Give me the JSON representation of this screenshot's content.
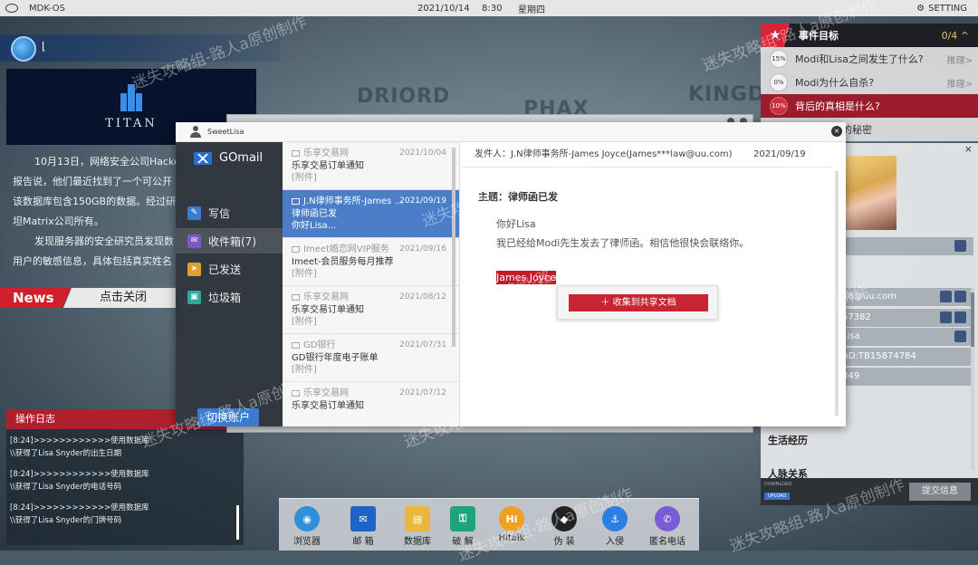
{
  "topbar": {
    "os_name": "MDK-OS",
    "date": "2021/10/14",
    "time": "8:30",
    "weekday": "星期四",
    "setting_label": "SETTING"
  },
  "map_labels": [
    "DRIORD",
    "PHAX",
    "KINGDO"
  ],
  "left_panel": {
    "company_name": "TITAN",
    "news_lines": [
      "10月13日，网络安全公司Hacke",
      "报告说，他们最近找到了一个可公开",
      "该数据库包含150GB的数据。经过研",
      "坦Matrix公司所有。",
      "发现服务器的安全研究员发现数",
      "用户的敏感信息，具体包括真实姓名"
    ],
    "news_tag": "News",
    "news_close": "点击关闭"
  },
  "oplog": {
    "title": "操作日志",
    "entries": [
      {
        "line1": "[8:24]>>>>>>>>>>>>使用数据库",
        "line2": "\\\\获得了Lisa Snyder的出生日期"
      },
      {
        "line1": "[8:24]>>>>>>>>>>>>使用数据库",
        "line2": "\\\\获得了Lisa Snyder的电话号码"
      },
      {
        "line1": "[8:24]>>>>>>>>>>>>使用数据库",
        "line2": "\\\\获得了Lisa Snyder的门牌号码"
      }
    ]
  },
  "events": {
    "title": "事件目标",
    "count": "0/4",
    "items": [
      {
        "pct": "15%",
        "question": "Modi和Lisa之间发生了什么?",
        "hint": "推理>"
      },
      {
        "pct": "0%",
        "question": "Modi为什么自杀?",
        "hint": "推理>"
      },
      {
        "pct": "10%",
        "question": "背后的真相是什么?",
        "hint": ""
      },
      {
        "pct": "",
        "question": "的秘密",
        "hint": ""
      }
    ]
  },
  "profile": {
    "close": "×",
    "rows": [
      "88@uu.com",
      "57382",
      "Lisa",
      "AD:TB15874784",
      "349"
    ],
    "section_life": "生活经历",
    "section_relations": "人脉关系",
    "download_label": "DOWNLOAD",
    "upload_label": "UPLOAD",
    "submit_label": "提交信息"
  },
  "gmail": {
    "window_user": "SweetLisa",
    "brand": "GOmail",
    "nav": [
      {
        "label": "写信",
        "icon": "compose-icon",
        "color": "#3a7bcf",
        "glyph": "✎"
      },
      {
        "label": "收件箱(7)",
        "icon": "inbox-icon",
        "color": "#7e57c2",
        "glyph": "✉"
      },
      {
        "label": "已发送",
        "icon": "sent-icon",
        "color": "#e0a030",
        "glyph": "➤"
      },
      {
        "label": "垃圾箱",
        "icon": "trash-icon",
        "color": "#2fa8a0",
        "glyph": "▣"
      }
    ],
    "switch_account": "切换账户",
    "mails": [
      {
        "from": "乐享交易网",
        "date": "2021/10/04",
        "subject": "乐享交易订单通知",
        "preview": "[附件]"
      },
      {
        "from": "J.N律师事务所-James ...",
        "date": "2021/09/19",
        "subject": "律师函已发",
        "preview": "你好Lisa..."
      },
      {
        "from": "Imeet婚恋网VIP服务",
        "date": "2021/09/16",
        "subject": "Imeet-会员服务每月推荐",
        "preview": "[附件]"
      },
      {
        "from": "乐享交易网",
        "date": "2021/08/12",
        "subject": "乐享交易订单通知",
        "preview": "[附件]"
      },
      {
        "from": "GD银行",
        "date": "2021/07/31",
        "subject": "GD银行年度电子账单",
        "preview": "[附件]"
      },
      {
        "from": "乐享交易网",
        "date": "2021/07/12",
        "subject": "乐享交易订单通知",
        "preview": ""
      }
    ],
    "active_mail_index": 1,
    "open_mail": {
      "sender": "发件人：J.N律师事务所-James Joyce(James***law@uu.com)",
      "date": "2021/09/19",
      "subject": "主题：律师函已发",
      "greeting": "你好Lisa",
      "body": "我已经给Modi先生发去了律师函。相信他很快会联络你。",
      "signature": "James Joyce",
      "context_action": "＋ 收集到共享文档"
    }
  },
  "dock": [
    {
      "label": "浏览器",
      "icon": "browser-icon",
      "color": "#2f8fd8",
      "glyph": "◉"
    },
    {
      "label": "邮 箱",
      "icon": "mail-icon",
      "color": "#1f63c7",
      "glyph": "✉"
    },
    {
      "label": "数据库",
      "icon": "database-icon",
      "color": "#e8b83a",
      "glyph": "▤"
    },
    {
      "label": "破 解",
      "icon": "crack-icon",
      "color": "#1fa37a",
      "glyph": "⚿"
    },
    {
      "label": "Hitalk",
      "icon": "hitalk-icon",
      "color": "#f0a020",
      "glyph": "Hi"
    },
    {
      "label": "伪 装",
      "icon": "disguise-icon",
      "color": "#222222",
      "glyph": "◆"
    },
    {
      "label": "入侵",
      "icon": "intrude-icon",
      "color": "#2a7fe0",
      "glyph": "⚓"
    },
    {
      "label": "匿名电话",
      "icon": "phone-icon",
      "color": "#7b5cd6",
      "glyph": "✆"
    }
  ],
  "watermark": "迷失攻略组-路人a原创制作",
  "colors": {
    "accent_red": "#c92434",
    "accent_blue": "#4a7ec8"
  }
}
